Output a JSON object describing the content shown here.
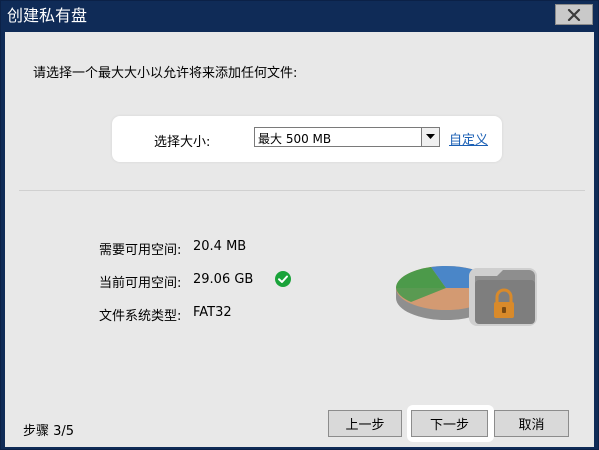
{
  "window": {
    "title": "创建私有盘",
    "close_icon": "close-icon"
  },
  "instruction": "请选择一个最大大小以允许将来添加任何文件:",
  "size_panel": {
    "label": "选择大小:",
    "selected_value": "最大 500 MB",
    "custom_link": "自定义"
  },
  "info": {
    "required_label": "需要可用空间:",
    "required_value": "20.4 MB",
    "current_label": "当前可用空间:",
    "current_value": "29.06 GB",
    "filesystem_label": "文件系统类型:",
    "filesystem_value": "FAT32",
    "status_icon": "check-icon",
    "status_color": "#1aa33a"
  },
  "graphic": {
    "icon": "disk-pie-lock-icon",
    "colors": {
      "blue": "#4a86c8",
      "green": "#4c9a4a",
      "orange": "#d39a72",
      "lock": "#d98a2a"
    }
  },
  "footer": {
    "step_label": "步骤  3/5",
    "prev_label": "上一步",
    "next_label": "下一步",
    "cancel_label": "取消"
  }
}
